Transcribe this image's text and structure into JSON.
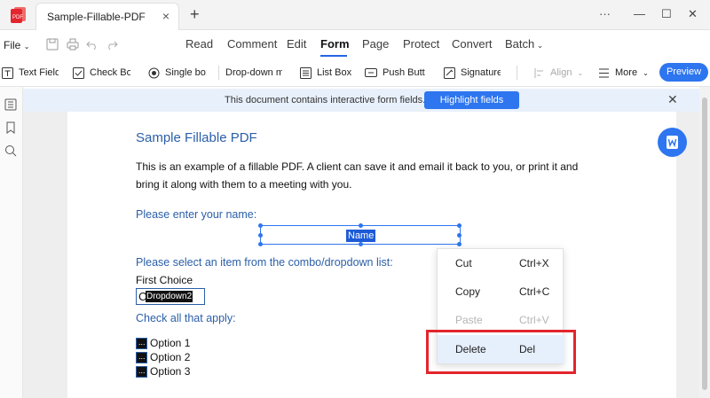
{
  "window": {
    "tab_title": "Sample-Fillable-PDF",
    "tab_close": "×",
    "new_tab": "+",
    "controls": {
      "more": "···",
      "minimize": "—",
      "maximize": "☐",
      "close": "✕"
    }
  },
  "menubar": {
    "file_label": "File",
    "items": [
      "Read",
      "Comment",
      "Edit",
      "Form",
      "Page",
      "Protect",
      "Convert",
      "Batch"
    ],
    "active": "Form"
  },
  "toolbar": {
    "text_field": "Text Field",
    "check_box": "Check Bo:",
    "single_box": "Single bo:",
    "dropdown": "Drop-down m",
    "list_box": "List Box",
    "push_button": "Push Buttc",
    "signature": "Signature",
    "align": "Align",
    "more": "More",
    "preview": "Preview"
  },
  "notification": {
    "text": "This document contains interactive form fields.",
    "button": "Highlight fields",
    "close": "✕"
  },
  "document": {
    "title": "Sample Fillable PDF",
    "paragraph": "This is an example of a fillable PDF. A client can save it and email it back to you, or print it and bring it along with them to a meeting with you.",
    "name_prompt": "Please enter your name:",
    "name_field_label": "Name",
    "combo_prompt": "Please select an item from the combo/dropdown list:",
    "first_choice": "First Choice",
    "dropdown_prefix": "C",
    "dropdown_label": "Dropdown2",
    "check_prompt": "Check all that apply:",
    "options": [
      "Option 1",
      "Option 2",
      "Option 3"
    ],
    "checkbox_marker": "...",
    "cut_off_text": "... ... ..... ...... ... ...... ..... ... ......."
  },
  "context_menu": {
    "items": [
      {
        "label": "Cut",
        "shortcut": "Ctrl+X",
        "enabled": true
      },
      {
        "label": "Copy",
        "shortcut": "Ctrl+C",
        "enabled": true
      },
      {
        "label": "Paste",
        "shortcut": "Ctrl+V",
        "enabled": false
      },
      {
        "label": "Delete",
        "shortcut": "Del",
        "enabled": true,
        "highlighted": true
      }
    ]
  },
  "colors": {
    "accent": "#2e75f0",
    "doc_heading": "#2b5fa8",
    "highlight_box": "#e3252d"
  }
}
